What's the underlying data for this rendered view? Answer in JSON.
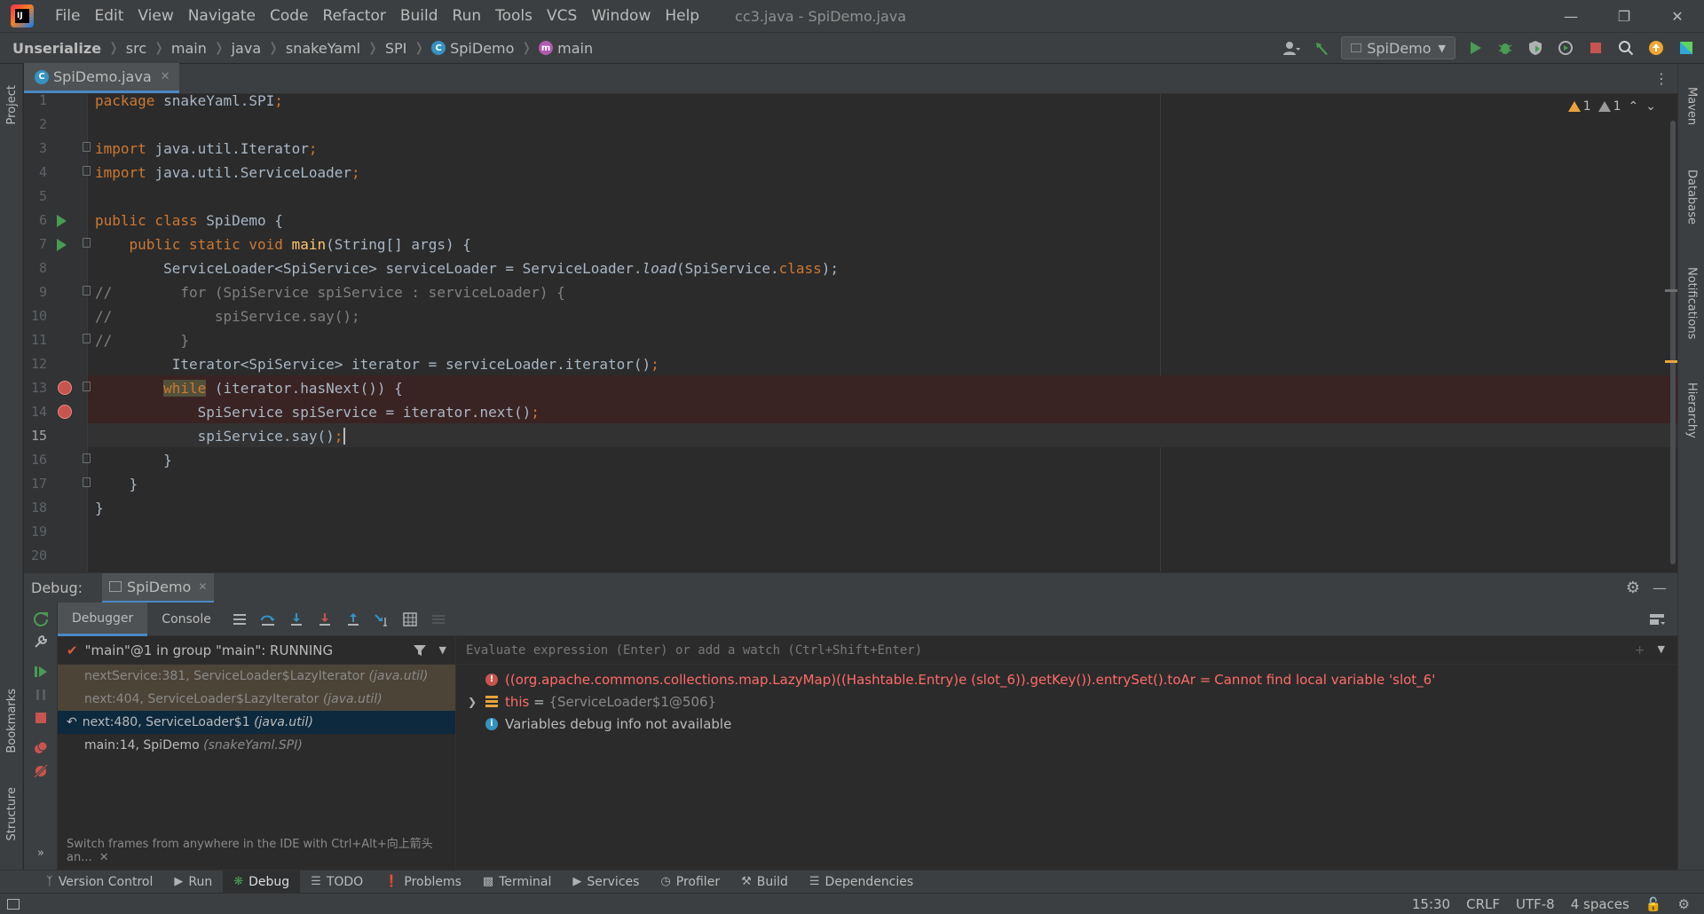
{
  "app": {
    "window_title": "cc3.java - SpiDemo.java",
    "menu": [
      "File",
      "Edit",
      "View",
      "Navigate",
      "Code",
      "Refactor",
      "Build",
      "Run",
      "Tools",
      "VCS",
      "Window",
      "Help"
    ]
  },
  "breadcrumb": [
    "Unserialize",
    "src",
    "main",
    "java",
    "snakeYaml",
    "SPI",
    "SpiDemo",
    "main"
  ],
  "run_config": "SpiDemo",
  "left_tools": {
    "project": "Project",
    "bookmarks": "Bookmarks",
    "structure": "Structure"
  },
  "right_tools": {
    "maven": "Maven",
    "database": "Database",
    "notifications": "Notifications",
    "hierarchy": "Hierarchy"
  },
  "editor": {
    "tab": "SpiDemo.java",
    "inspections": {
      "warnings": "1",
      "weak_warnings": "1"
    },
    "line_numbers": [
      "1",
      "2",
      "3",
      "4",
      "5",
      "6",
      "7",
      "8",
      "9",
      "10",
      "11",
      "12",
      "13",
      "14",
      "15",
      "16",
      "17",
      "18",
      "19",
      "20"
    ],
    "code": {
      "l1a": "package ",
      "l1b": "snakeYaml.SPI",
      ";": ";",
      "l3a": "import ",
      "l3b": "java.util.Iterator",
      "l3c": ";",
      "l4a": "import ",
      "l4b": "java.util.ServiceLoader",
      "l4c": ";",
      "l6a": "public class ",
      "l6b": "SpiDemo {",
      "l7a": "    public static void ",
      "l7b": "main",
      "l7c": "(String[] args) {",
      "l8a": "        ServiceLoader<SpiService> serviceLoader = ServiceLoader.",
      "l8b": "load",
      "l8c": "(SpiService.",
      "l8d": "class",
      "l8e": ");",
      "l9": "//        for (SpiService spiService : serviceLoader) {",
      "l10": "//            spiService.say();",
      "l11": "//        }",
      "l12a": "         Iterator<SpiService> iterator = serviceLoader.iterator()",
      "l12b": ";",
      "l13a": "        ",
      "l13b": "while",
      "l13c": " (iterator.hasNext()) {",
      "l14a": "            SpiService spiService = iterator.next()",
      "l14b": ";",
      "l15a": "            spiService.say()",
      "l15b": ";",
      "l16": "        }",
      "l17": "    }",
      "l18": "}"
    }
  },
  "debug": {
    "label": "Debug:",
    "tab": "SpiDemo",
    "subtabs": [
      "Debugger",
      "Console"
    ],
    "thread": "\"main\"@1 in group \"main\": RUNNING",
    "frames": [
      {
        "method": "nextService:381, ServiceLoader$LazyIterator",
        "pkg": "(java.util)"
      },
      {
        "method": "next:404, ServiceLoader$LazyIterator",
        "pkg": "(java.util)"
      },
      {
        "method": "next:480, ServiceLoader$1",
        "pkg": "(java.util)"
      },
      {
        "method": "main:14, SpiDemo",
        "pkg": "(snakeYaml.SPI)"
      }
    ],
    "hint": "Switch frames from anywhere in the IDE with Ctrl+Alt+向上箭头 an...",
    "eval_placeholder": "Evaluate expression (Enter) or add a watch (Ctrl+Shift+Enter)",
    "vars": {
      "error_expr": "((org.apache.commons.collections.map.LazyMap)((Hashtable.Entry)e (slot_6)).getKey()).entrySet().toAr = ",
      "error_msg": "Cannot find local variable 'slot_6'",
      "this_name": "this",
      "this_eq": " = ",
      "this_val": "{ServiceLoader$1@506}",
      "info": "Variables debug info not available"
    }
  },
  "tool_windows": [
    "Version Control",
    "Run",
    "Debug",
    "TODO",
    "Problems",
    "Terminal",
    "Services",
    "Profiler",
    "Build",
    "Dependencies"
  ],
  "status": {
    "position": "15:30",
    "line_sep": "CRLF",
    "encoding": "UTF-8",
    "indent": "4 spaces"
  },
  "colors": {
    "keyword": "#cc7832",
    "method": "#ffc66d",
    "comment": "#808080",
    "error": "#ff6b68",
    "accent": "#4a88c7"
  }
}
